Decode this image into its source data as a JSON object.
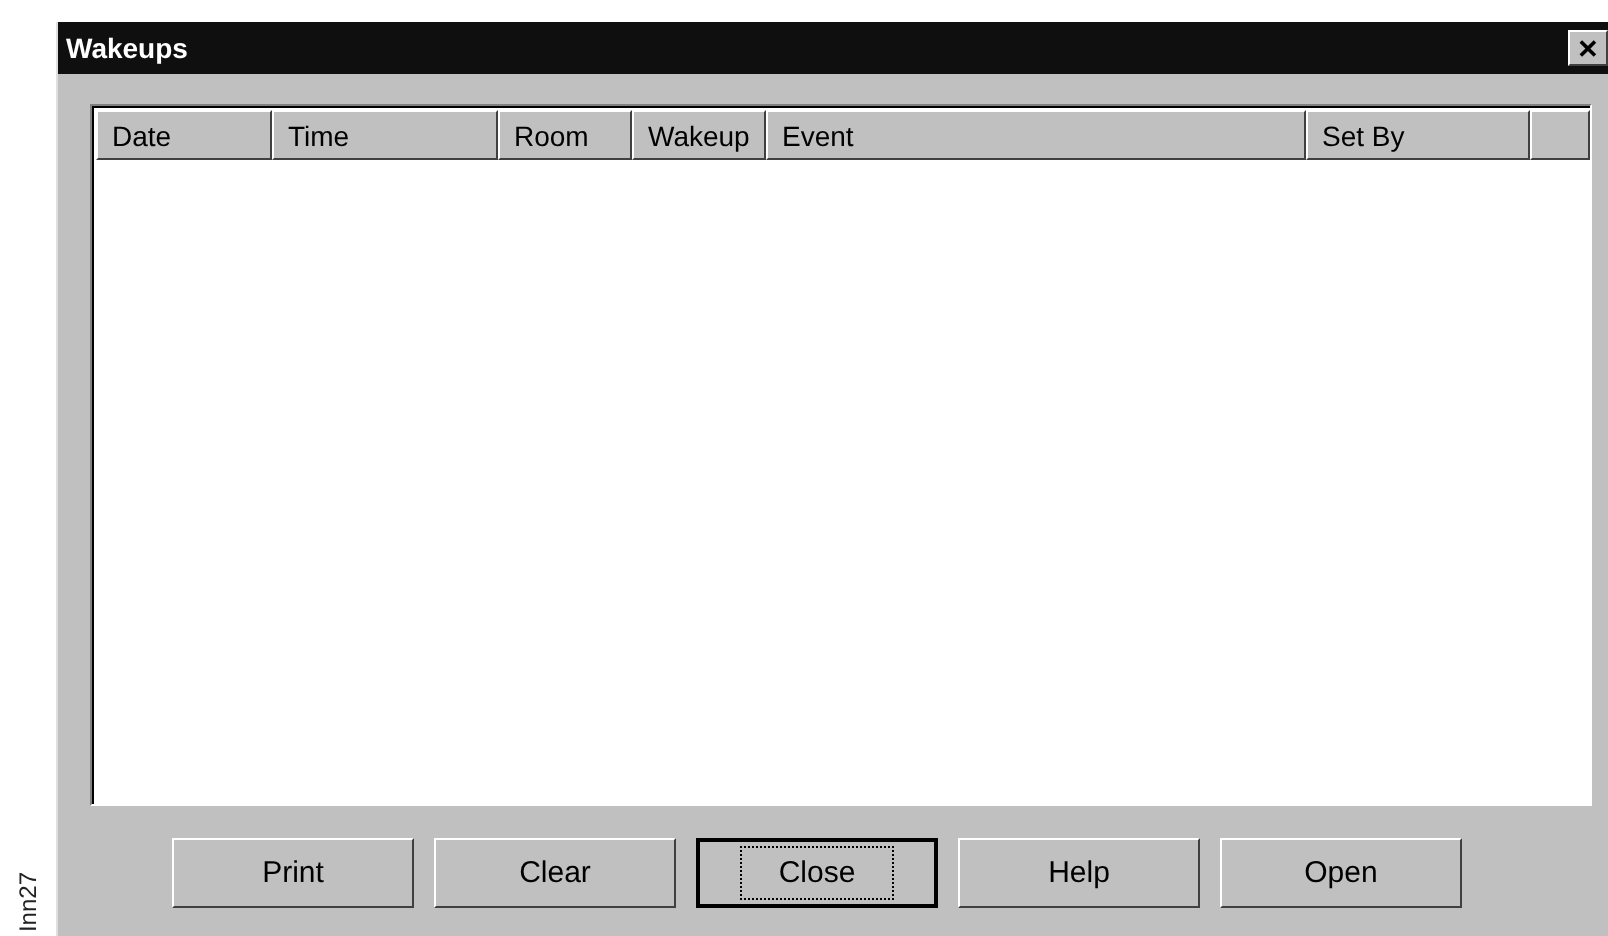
{
  "figure_label": "Inn27",
  "window": {
    "title": "Wakeups",
    "close": "✕"
  },
  "table": {
    "columns": [
      "Date",
      "Time",
      "Room",
      "Wakeup",
      "Event",
      "Set By"
    ]
  },
  "buttons": [
    {
      "label": "Print",
      "default": false
    },
    {
      "label": "Clear",
      "default": false
    },
    {
      "label": "Close",
      "default": true
    },
    {
      "label": "Help",
      "default": false
    },
    {
      "label": "Open",
      "default": false
    }
  ]
}
